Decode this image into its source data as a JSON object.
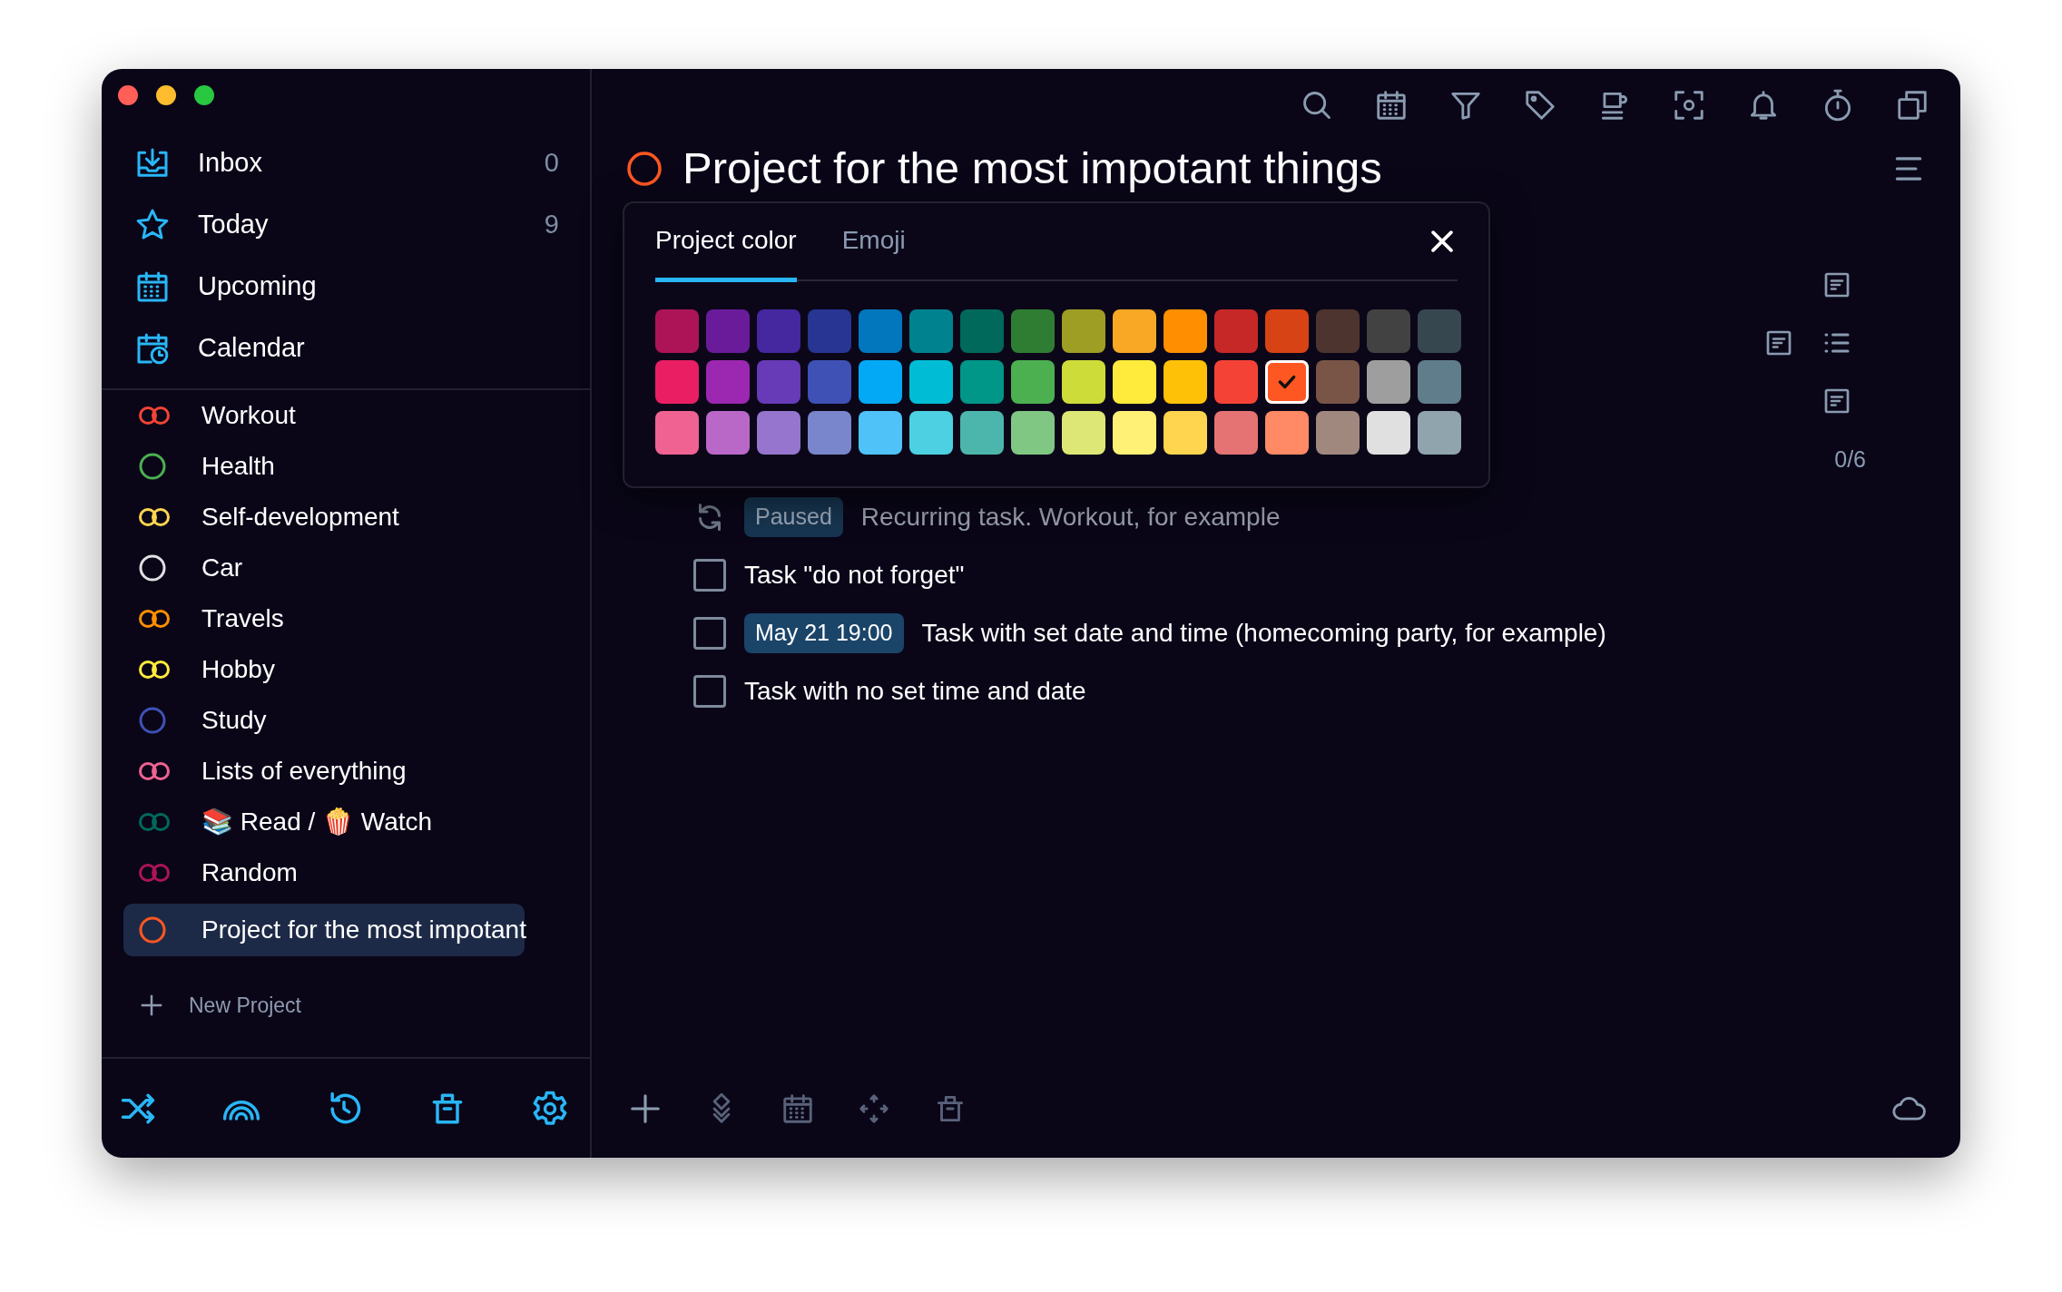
{
  "sidebar": {
    "nav": [
      {
        "label": "Inbox",
        "count": "0"
      },
      {
        "label": "Today",
        "count": "9"
      },
      {
        "label": "Upcoming"
      },
      {
        "label": "Calendar"
      }
    ],
    "projects": [
      {
        "name": "Workout",
        "kind": "linked",
        "color": "#f44336",
        "selected": false
      },
      {
        "name": "Health",
        "kind": "single",
        "color": "#4caf50",
        "selected": false
      },
      {
        "name": "Self-development",
        "kind": "linked",
        "color": "#ffd54f",
        "selected": false
      },
      {
        "name": "Car",
        "kind": "single",
        "color": "#e0e0e0",
        "selected": false
      },
      {
        "name": "Travels",
        "kind": "linked",
        "color": "#ff8f00",
        "selected": false
      },
      {
        "name": "Hobby",
        "kind": "linked",
        "color": "#ffeb3b",
        "selected": false
      },
      {
        "name": "Study",
        "kind": "single",
        "color": "#3f51b5",
        "selected": false
      },
      {
        "name": "Lists of everything",
        "kind": "linked",
        "color": "#f06292",
        "selected": false
      },
      {
        "name": "📚 Read / 🍿 Watch",
        "kind": "linked",
        "color": "#00695c",
        "selected": false
      },
      {
        "name": "Random",
        "kind": "linked",
        "color": "#ad1457",
        "selected": false
      },
      {
        "name": "Project for the most impotant",
        "kind": "single",
        "color": "#ff5722",
        "selected": true
      }
    ],
    "new_project": "New Project"
  },
  "project": {
    "title": "Project for the most impotant things"
  },
  "color_popup": {
    "tabs": [
      {
        "label": "Project color",
        "selected": true
      },
      {
        "label": "Emoji",
        "selected": false
      }
    ],
    "swatches": [
      [
        {
          "color": "#ad1457",
          "selected": false
        },
        {
          "color": "#6a1b9a",
          "selected": false
        },
        {
          "color": "#4527a0",
          "selected": false
        },
        {
          "color": "#283593",
          "selected": false
        },
        {
          "color": "#0277bd",
          "selected": false
        },
        {
          "color": "#00838f",
          "selected": false
        },
        {
          "color": "#00695c",
          "selected": false
        },
        {
          "color": "#2e7d32",
          "selected": false
        },
        {
          "color": "#9e9d24",
          "selected": false
        },
        {
          "color": "#f9a825",
          "selected": false
        },
        {
          "color": "#ff8f00",
          "selected": false
        },
        {
          "color": "#c62828",
          "selected": false
        },
        {
          "color": "#d84315",
          "selected": false
        },
        {
          "color": "#4e342e",
          "selected": false
        },
        {
          "color": "#424242",
          "selected": false
        },
        {
          "color": "#37474f",
          "selected": false
        }
      ],
      [
        {
          "color": "#e91e63",
          "selected": false
        },
        {
          "color": "#9c27b0",
          "selected": false
        },
        {
          "color": "#673ab7",
          "selected": false
        },
        {
          "color": "#3f51b5",
          "selected": false
        },
        {
          "color": "#03a9f4",
          "selected": false
        },
        {
          "color": "#00bcd4",
          "selected": false
        },
        {
          "color": "#009688",
          "selected": false
        },
        {
          "color": "#4caf50",
          "selected": false
        },
        {
          "color": "#cddc39",
          "selected": false
        },
        {
          "color": "#ffeb3b",
          "selected": false
        },
        {
          "color": "#ffc107",
          "selected": false
        },
        {
          "color": "#f44336",
          "selected": false
        },
        {
          "color": "#ff5722",
          "selected": true
        },
        {
          "color": "#795548",
          "selected": false
        },
        {
          "color": "#9e9e9e",
          "selected": false
        },
        {
          "color": "#607d8b",
          "selected": false
        }
      ],
      [
        {
          "color": "#f06292",
          "selected": false
        },
        {
          "color": "#ba68c8",
          "selected": false
        },
        {
          "color": "#9575cd",
          "selected": false
        },
        {
          "color": "#7986cb",
          "selected": false
        },
        {
          "color": "#4fc3f7",
          "selected": false
        },
        {
          "color": "#4dd0e1",
          "selected": false
        },
        {
          "color": "#4db6ac",
          "selected": false
        },
        {
          "color": "#81c784",
          "selected": false
        },
        {
          "color": "#dce775",
          "selected": false
        },
        {
          "color": "#fff176",
          "selected": false
        },
        {
          "color": "#ffd54f",
          "selected": false
        },
        {
          "color": "#e57373",
          "selected": false
        },
        {
          "color": "#ff8a65",
          "selected": false
        },
        {
          "color": "#a1887f",
          "selected": false
        },
        {
          "color": "#e0e0e0",
          "selected": false
        },
        {
          "color": "#90a4ae",
          "selected": false
        }
      ]
    ]
  },
  "tasks": [
    {
      "kind": "recurring",
      "badge": "Paused",
      "text": "Recurring task. Workout, for example"
    },
    {
      "kind": "checkbox",
      "checked": false,
      "text": "Task \"do not forget\""
    },
    {
      "kind": "checkbox",
      "checked": false,
      "date": "May 21 19:00",
      "text": "Task with set date and time (homecoming party, for example)"
    },
    {
      "kind": "checkbox",
      "checked": false,
      "text": "Task with no set time and date"
    }
  ],
  "side_panel": {
    "progress": "0/6"
  }
}
